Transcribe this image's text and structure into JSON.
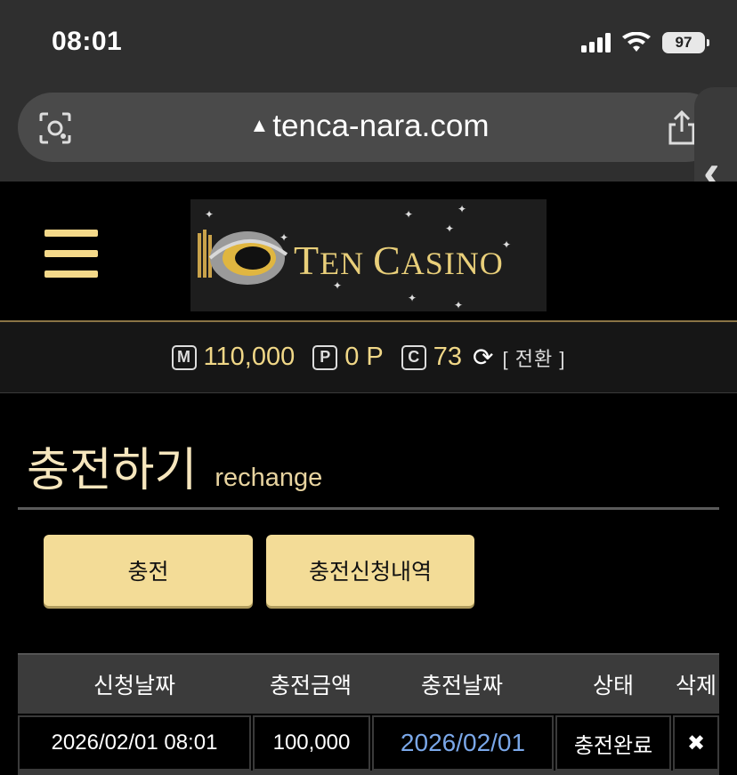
{
  "status": {
    "time": "08:01",
    "battery": "97"
  },
  "browser": {
    "url": "tenca-nara.com",
    "warning_icon": "warning-icon",
    "colors": {
      "chrome": "#2f2f2f",
      "urlbar": "#4a4a4a"
    }
  },
  "site": {
    "logo_text_first": "T",
    "logo_text_rest": "EN ",
    "logo_text_second": "C",
    "logo_text_second_rest": "ASINO",
    "accent": "#f3dc97"
  },
  "balance": {
    "money_badge": "M",
    "money": "110,000",
    "point_badge": "P",
    "point": "0 P",
    "coupon_badge": "C",
    "coupon": "73",
    "switch_label": "[ 전환 ]"
  },
  "page": {
    "title_ko": "충전하기",
    "title_en": "rechange"
  },
  "buttons": {
    "charge": "충전",
    "history": "충전신청내역"
  },
  "table": {
    "headers": [
      "신청날짜",
      "충전금액",
      "충전날짜",
      "상태",
      "삭제"
    ],
    "rows": [
      {
        "request_date": "2026/02/01 08:01",
        "amount": "100,000",
        "charge_date": "2026/02/01",
        "status": "충전완료",
        "delete": "✖"
      }
    ]
  }
}
